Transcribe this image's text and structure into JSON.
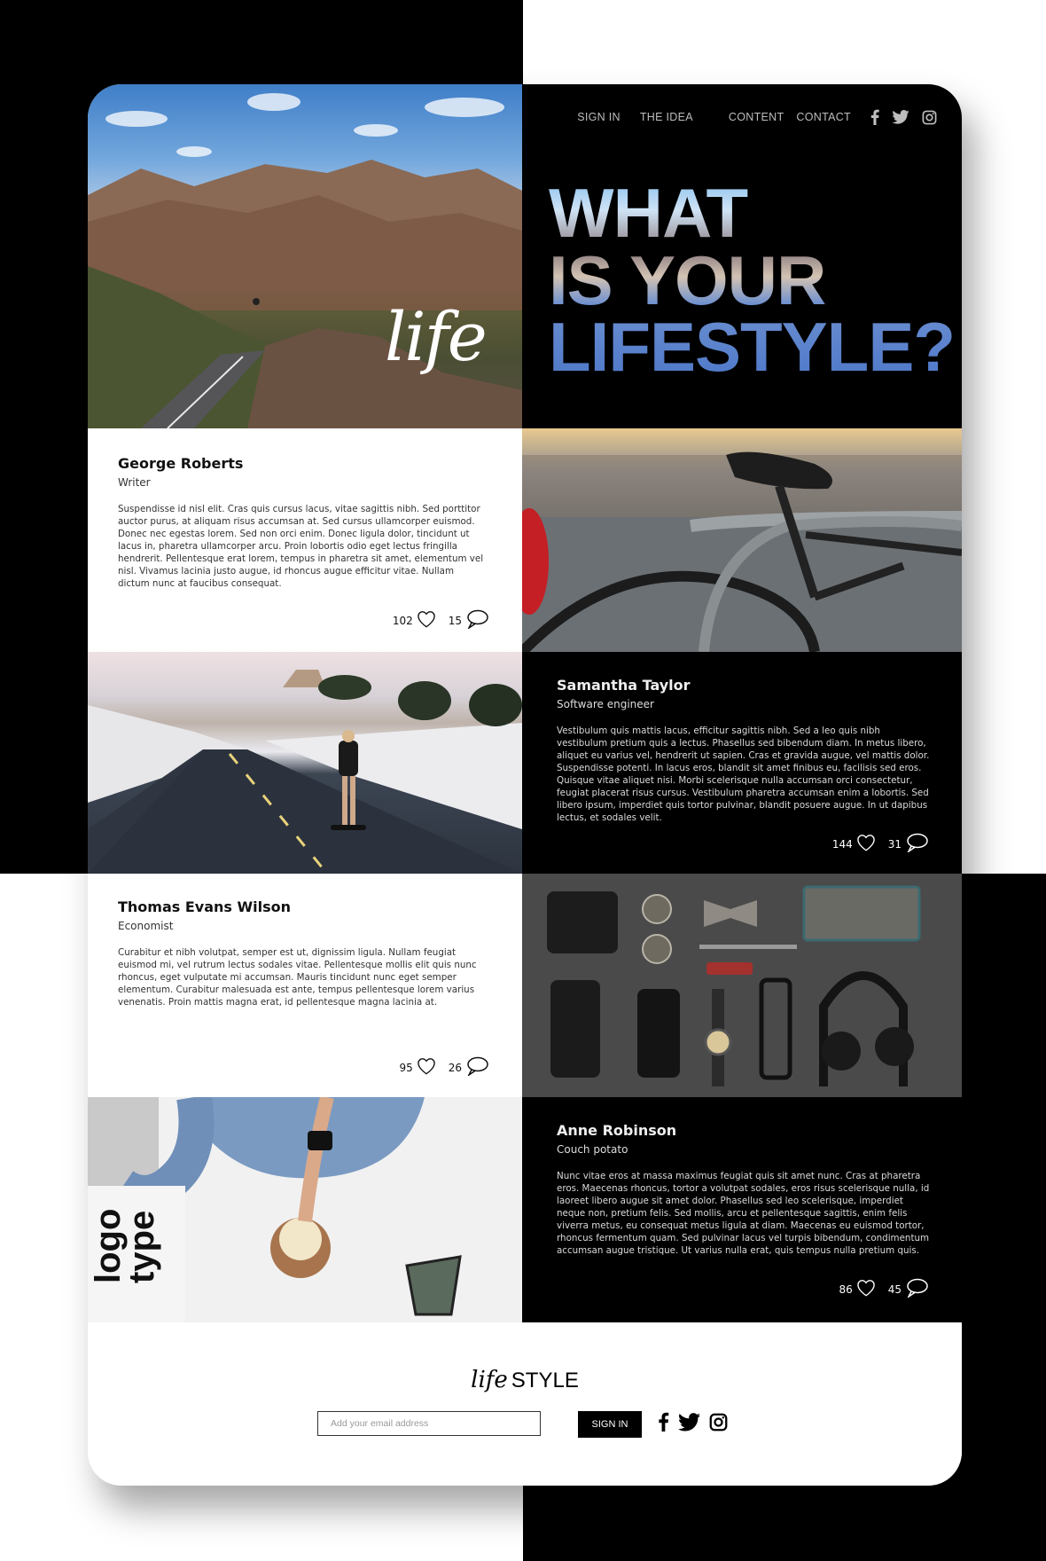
{
  "nav": {
    "items": [
      "SIGN IN",
      "THE IDEA",
      "CONTENT",
      "CONTACT"
    ],
    "social": [
      "facebook-icon",
      "twitter-icon",
      "instagram-icon"
    ]
  },
  "hero": {
    "image_word": "life",
    "headline": [
      "WHAT",
      "IS YOUR",
      "LIFESTYLE?"
    ]
  },
  "profiles": [
    {
      "name": "George Roberts",
      "role": "Writer",
      "body": "Suspendisse id nisl elit. Cras quis cursus lacus, vitae sagittis nibh. Sed porttitor auctor purus, at aliquam risus accumsan at. Sed cursus ullamcorper euismod. Donec nec egestas lorem. Sed non orci enim. Donec ligula dolor, tincidunt ut lacus in, pharetra ullamcorper arcu. Proin lobortis odio eget lectus fringilla hendrerit. Pellentesque erat lorem, tempus in pharetra sit amet, elementum vel nisl. Vivamus lacinia justo augue, id rhoncus augue efficitur vitae. Nullam dictum nunc at faucibus consequat.",
      "likes": "102",
      "comments": "15"
    },
    {
      "name": "Samantha Taylor",
      "role": "Software engineer",
      "body": "Vestibulum quis mattis lacus, efficitur sagittis nibh. Sed a leo quis nibh vestibulum pretium quis a lectus. Phasellus sed bibendum diam. In metus libero, aliquet eu varius vel, hendrerit ut sapien. Cras et gravida augue, vel mattis dolor. Suspendisse potenti. In lacus eros, blandit sit amet finibus eu, facilisis sed eros. Quisque vitae aliquet nisi. Morbi scelerisque nulla accumsan orci consectetur, feugiat placerat risus cursus. Vestibulum pharetra accumsan enim a lobortis. Sed libero ipsum, imperdiet quis tortor pulvinar, blandit posuere augue. In ut dapibus lectus, et sodales velit.",
      "likes": "144",
      "comments": "31"
    },
    {
      "name": "Thomas Evans Wilson",
      "role": "Economist",
      "body": "Curabitur et nibh volutpat, semper est ut, dignissim ligula. Nullam feugiat euismod mi, vel rutrum lectus sodales vitae. Pellentesque mollis elit quis nunc rhoncus, eget vulputate mi accumsan. Mauris tincidunt nunc eget semper elementum. Curabitur malesuada est ante, tempus pellentesque lorem varius venenatis. Proin mattis magna erat, id pellentesque magna lacinia at.",
      "likes": "95",
      "comments": "26"
    },
    {
      "name": "Anne Robinson",
      "role": "Couch potato",
      "body": "Nunc vitae eros at massa maximus feugiat quis sit amet nunc. Cras at pharetra eros. Maecenas rhoncus, tortor a volutpat sodales, eros risus scelerisque nulla, id laoreet libero augue sit amet dolor. Phasellus sed leo scelerisque, imperdiet neque non, pretium felis. Sed mollis, arcu et pellentesque sagittis, enim felis viverra metus, eu consequat metus ligula at diam. Maecenas eu euismod tortor, rhoncus fermentum quam. Sed pulvinar lacus vel turpis bibendum, condimentum accumsan augue tristique. Ut varius nulla erat, quis tempus nulla pretium quis.",
      "likes": "86",
      "comments": "45"
    }
  ],
  "photo_text": {
    "logotype": "logo type"
  },
  "footer": {
    "logo_script": "life",
    "logo_text": "STYLE",
    "email_placeholder": "Add your email address",
    "button": "SIGN IN"
  },
  "colors": {
    "dark": "#000000",
    "light": "#ffffff",
    "accent_blue": "#4e78c9"
  }
}
